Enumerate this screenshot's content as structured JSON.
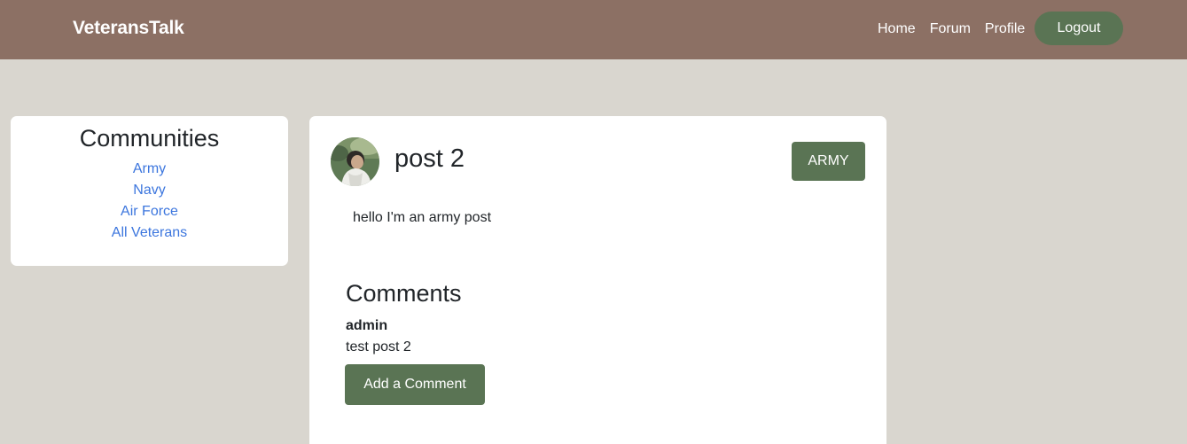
{
  "navbar": {
    "brand": "VeteransTalk",
    "links": [
      "Home",
      "Forum",
      "Profile"
    ],
    "logout_label": "Logout"
  },
  "communities": {
    "title": "Communities",
    "items": [
      "Army",
      "Navy",
      "Air Force",
      "All Veterans"
    ]
  },
  "post": {
    "title": "post 2",
    "tag": "ARMY",
    "body": "hello I'm an army post",
    "avatar_icon": "user-avatar-photo"
  },
  "comments": {
    "title": "Comments",
    "items": [
      {
        "author": "admin",
        "text": "test post 2"
      }
    ],
    "add_label": "Add a Comment"
  },
  "colors": {
    "navbar": "#8c7064",
    "background": "#d9d6cf",
    "accent_green": "#5a7454",
    "link_blue": "#3c76de"
  }
}
